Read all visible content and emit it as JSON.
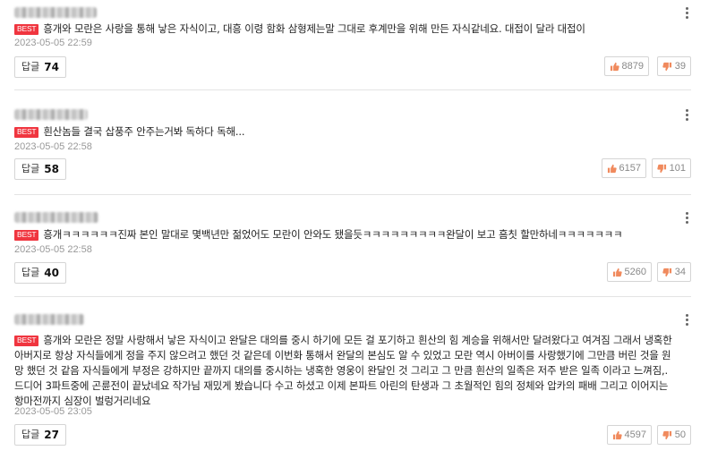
{
  "best_label": "BEST",
  "reply_label": "답글",
  "icons": {
    "like": "thumbs-up-icon",
    "dislike": "thumbs-down-icon",
    "more": "more-vertical-icon"
  },
  "colors": {
    "best_badge": "#f0353f",
    "vote_icon": "#f08a5d"
  },
  "comments": [
    {
      "text": "흥개와 모란은 사랑을 통해 낳은 자식이고, 대흥 이령 함화 삼형제는말 그대로 후계만을 위해 만든 자식같네요. 대접이 달라 대접이",
      "date": "2023-05-05 22:59",
      "replies": "74",
      "likes": "8879",
      "dislikes": "39"
    },
    {
      "text": "흰산놈들 결국 삽풍주 안주는거봐 독하다 독해...",
      "date": "2023-05-05 22:58",
      "replies": "58",
      "likes": "6157",
      "dislikes": "101"
    },
    {
      "text": "흥개ㅋㅋㅋㅋㅋㅋ진짜 본인 말대로 몇백년만 젊었어도 모란이 안와도 됐을듯ㅋㅋㅋㅋㅋㅋㅋㅋㅋ완달이 보고 흠칫 할만하네ㅋㅋㅋㅋㅋㅋㅋ",
      "date": "2023-05-05 22:58",
      "replies": "40",
      "likes": "5260",
      "dislikes": "34"
    },
    {
      "text": "흥개와 모란은 정말 사랑해서 낳은 자식이고 완달은 대의를 중시 하기에 모든 걸 포기하고 흰산의 힘 계승을 위해서만 달려왔다고 여겨짐 그래서 냉혹한 아버지로 항상 자식들에게 정을 주지 않으려고 했던 것 같은데 이번화 통해서 완달의 본심도 알 수 있었고 모란 역시 아버이를 사랑했기에 그만큼 버린 것을 원망 했던 것 같음 자식들에게 부정은 강하지만 끝까지 대의를 중시하는 냉혹한 영웅이 완달인 것 그리고 그 만큼 흰산의 일족은 저주 받은 일족 이라고 느껴짐,. 드디어 3파트중에 곤륜전이 끝났네요 작가님 재밌게 봤습니다 수고 하셨고 이제 본파트 아린의 탄생과 그 초월적인 힘의 정체와 압카의 패배 그리고 이어지는 항마전까지 심장이 벌렁거리네요",
      "date": "2023-05-05 23:05",
      "replies": "27",
      "likes": "4597",
      "dislikes": "50"
    }
  ]
}
